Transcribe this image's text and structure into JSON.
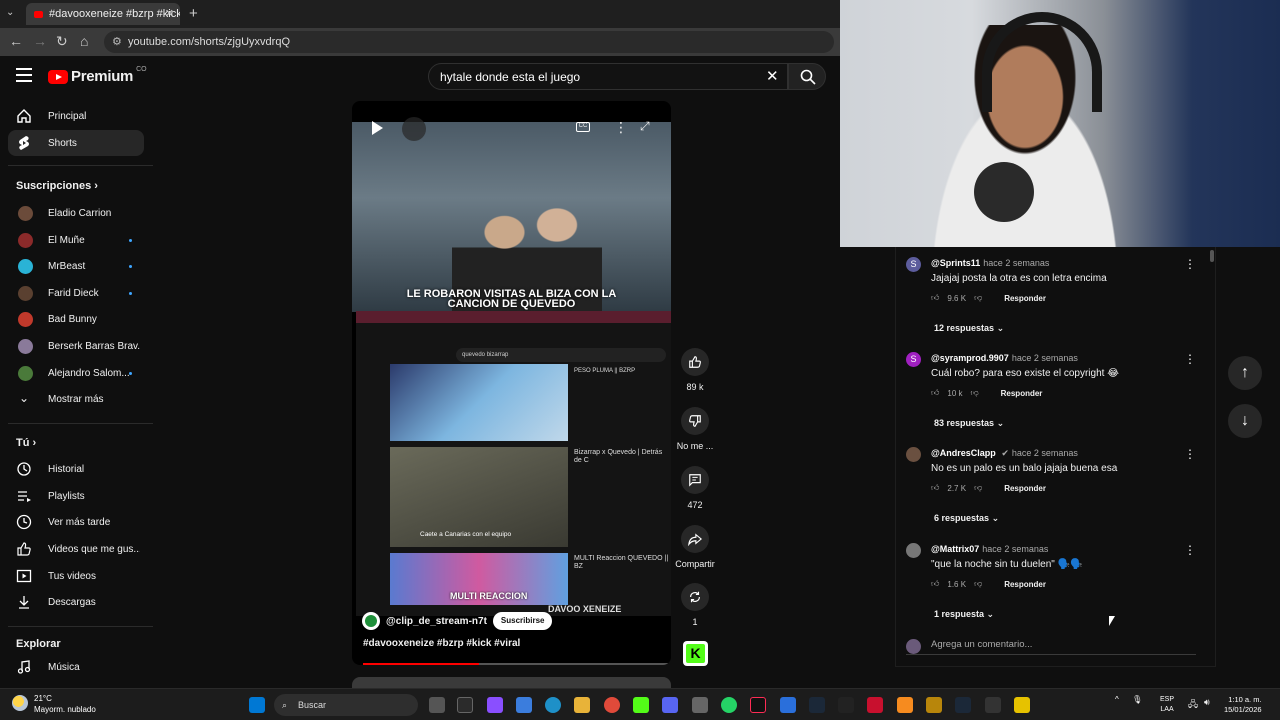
{
  "browser": {
    "tab_title": "#davooxeneize #bzrp #kick #vi",
    "url": "youtube.com/shorts/zjgUyxvdrqQ"
  },
  "header": {
    "logo_text": "Premium",
    "logo_region": "CO",
    "search_value": "hytale donde esta el juego"
  },
  "sidebar": {
    "main": [
      {
        "label": "Principal",
        "icon": "home-icon"
      },
      {
        "label": "Shorts",
        "icon": "shorts-icon"
      }
    ],
    "subscriptions_heading": "Suscripciones",
    "subscriptions": [
      {
        "label": "Eladio Carrion",
        "new": false,
        "color": "#6b4b3a"
      },
      {
        "label": "El Muñe",
        "new": true,
        "color": "#8b2a2a"
      },
      {
        "label": "MrBeast",
        "new": true,
        "color": "#2ab3d6"
      },
      {
        "label": "Farid Dieck",
        "new": true,
        "color": "#5a4030"
      },
      {
        "label": "Bad Bunny",
        "new": false,
        "color": "#c0392b"
      },
      {
        "label": "Berserk Barras Brav...",
        "new": false,
        "color": "#8a7a9a"
      },
      {
        "label": "Alejandro Salom...",
        "new": true,
        "color": "#4a7a3a"
      }
    ],
    "show_more": "Mostrar más",
    "you_heading": "Tú",
    "you_items": [
      {
        "label": "Historial",
        "icon": "history-icon"
      },
      {
        "label": "Playlists",
        "icon": "playlists-icon"
      },
      {
        "label": "Ver más tarde",
        "icon": "watch-later-icon"
      },
      {
        "label": "Videos que me gus...",
        "icon": "liked-icon"
      },
      {
        "label": "Tus videos",
        "icon": "your-videos-icon"
      },
      {
        "label": "Descargas",
        "icon": "downloads-icon"
      }
    ],
    "explore_heading": "Explorar",
    "explore_items": [
      {
        "label": "Música",
        "icon": "music-icon"
      }
    ]
  },
  "video": {
    "caption_line1": "LE ROBARON VISITAS AL BIZA CON LA",
    "caption_line2": "CANCION DE QUEVEDO",
    "screen_search": "quevedo bizarrap",
    "thumb2_title": "Bizarrap x Quevedo | Detrás de C",
    "thumb3_title": "MULTI Reaccion QUEVEDO || BZ",
    "thumb3_overlay": "MULTI REACCION",
    "thumb2_caption": "Caete a Canarias con el equipo",
    "brand": "DAVOO XENEIZE",
    "channel": "@clip_de_stream-n7t",
    "subscribe": "Suscribirse",
    "title": "#davooxeneize #bzrp #kick #viral",
    "progress": 0.38
  },
  "actions": {
    "likes": "89 k",
    "dislike": "No me ...",
    "comments": "472",
    "share": "Compartir",
    "remix": "1"
  },
  "comments": [
    {
      "author": "@Sprints11",
      "time": "hace 2 semanas",
      "text": "Jajajaj posta la otra es con letra encima",
      "likes": "9.6 K",
      "replies": "12 respuestas",
      "avatar_letter": "S",
      "avatar_color": "#5c5c9c",
      "verified": false
    },
    {
      "author": "@syramprod.9907",
      "time": "hace 2 semanas",
      "text": "Cuál robo? para eso existe el copyright 😂",
      "likes": "10 k",
      "replies": "83 respuestas",
      "avatar_letter": "S",
      "avatar_color": "#a020c0",
      "verified": false
    },
    {
      "author": "@AndresClapp",
      "time": "hace 2 semanas",
      "text": "No es un palo es un balo jajaja buena esa",
      "likes": "2.7 K",
      "replies": "6 respuestas",
      "avatar_letter": "",
      "avatar_color": "#6a5040",
      "verified": true
    },
    {
      "author": "@Mattrix07",
      "time": "hace 2 semanas",
      "text": "\"que la noche sin tu duelen\" 🗣️🗣️",
      "likes": "1.6 K",
      "replies": "1 respuesta",
      "avatar_letter": "",
      "avatar_color": "#777777",
      "verified": false
    }
  ],
  "comment_reply": "Responder",
  "add_comment_placeholder": "Agrega un comentario...",
  "taskbar": {
    "temp": "21°C",
    "weather": "Mayorm. nublado",
    "search": "Buscar",
    "lang1": "ESP",
    "lang2": "LAA",
    "time": "1:10 a. m.",
    "date": "15/01/2026"
  }
}
